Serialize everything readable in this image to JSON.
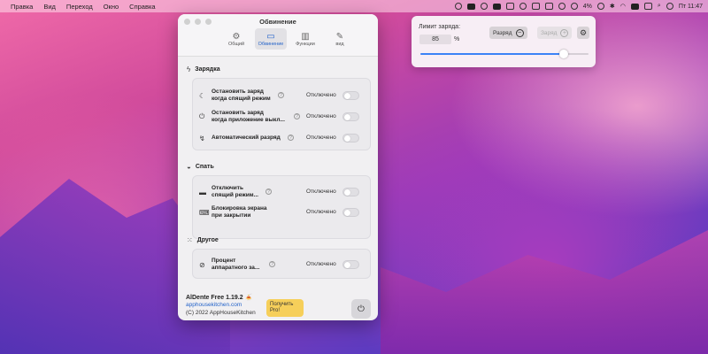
{
  "menubar": {
    "apple_icon": "apple-icon",
    "items": [
      "Правка",
      "Вид",
      "Переход",
      "Окно",
      "Справка"
    ],
    "battery_percent": "4%",
    "keyboard_layout": "RU",
    "clock": "Пт 11:47"
  },
  "window": {
    "title": "Обвинение",
    "tabs": [
      {
        "label": "Общий",
        "icon": "gear-icon"
      },
      {
        "label": "Обвинение",
        "icon": "battery-icon"
      },
      {
        "label": "Функции",
        "icon": "books-icon"
      },
      {
        "label": "вид",
        "icon": "brush-icon"
      }
    ],
    "active_tab": "Обвинение",
    "sections": [
      {
        "title": "Зарядка",
        "icon": "bolt-icon",
        "rows": [
          {
            "label_line1": "Остановить заряд",
            "label_line2": "когда спящий режим",
            "value": "Отключено",
            "icon": "moon-icon"
          },
          {
            "label_line1": "Остановить заряд",
            "label_line2": "когда приложение выкл...",
            "value": "Отключено",
            "icon": "power-icon"
          },
          {
            "label_line1": "Автоматический разряд",
            "label_line2": "",
            "value": "Отключено",
            "icon": "auto-discharge-icon"
          }
        ]
      },
      {
        "title": "Спать",
        "icon": "sleep-icon",
        "rows": [
          {
            "label_line1": "Отключить",
            "label_line2": "спящий режим...",
            "value": "Отключено",
            "icon": "bed-icon"
          },
          {
            "label_line1": "Блокировка экрана",
            "label_line2": "при закрытии",
            "value": "Отключено",
            "icon": "laptop-icon"
          }
        ]
      },
      {
        "title": "Другое",
        "icon": "dots-icon",
        "rows": [
          {
            "label_line1": "Процент",
            "label_line2": "аппаратного за...",
            "value": "Отключено",
            "icon": "percent-icon"
          }
        ]
      }
    ],
    "footer": {
      "app_name": "AlDente Free 1.19.2 🍝",
      "link": "apphousekitchen.com",
      "copyright": "(C) 2022 AppHouseKitchen",
      "pro_button_line1": "Получить",
      "pro_button_line2": "Pro!"
    }
  },
  "popover": {
    "label": "Лимит заряда:",
    "value": "85",
    "unit": "%",
    "discharge_label": "Разряд",
    "charge_label": "Заряд",
    "slider_percent": 85,
    "accent": "#3b82f6"
  }
}
